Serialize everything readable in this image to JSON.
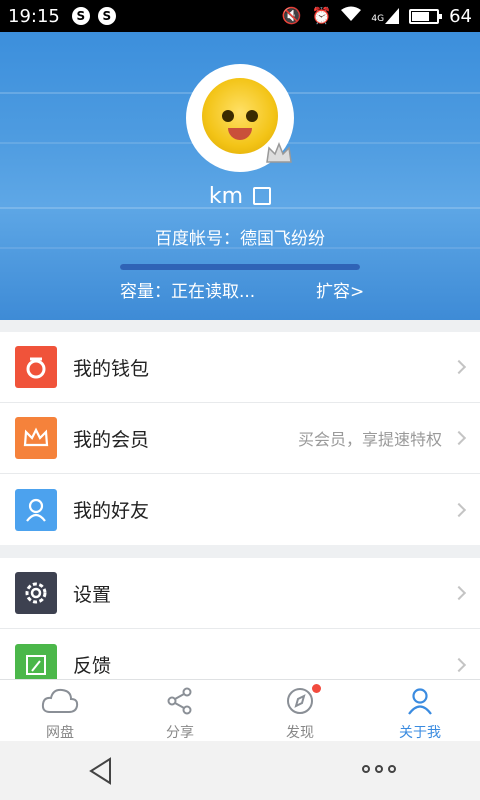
{
  "status_bar": {
    "time": "19:15",
    "battery": "64",
    "battery_level": 0.64,
    "network": "4G",
    "icons": [
      "notification-s-icon",
      "notification-s-icon",
      "mute-icon",
      "alarm-icon",
      "wifi-icon",
      "signal-icon",
      "battery-icon"
    ]
  },
  "profile": {
    "username": "km",
    "account": "百度帐号：德国飞纷纷",
    "capacity": "容量：正在读取...",
    "expand": "扩容>",
    "storage_fill": 1.0
  },
  "menu": {
    "wallet": {
      "label": "我的钱包",
      "icon": "wallet-icon",
      "color": "#f0533a"
    },
    "vip": {
      "label": "我的会员",
      "hint": "买会员，享提速特权",
      "icon": "crown-icon",
      "color": "#f5823b"
    },
    "friends": {
      "label": "我的好友",
      "icon": "friend-icon",
      "color": "#4ca2ee"
    },
    "settings": {
      "label": "设置",
      "icon": "settings-gear-icon",
      "color": "#3d4150"
    },
    "feedback": {
      "label": "反馈",
      "icon": "feedback-icon",
      "color": "#4bb74a"
    }
  },
  "tabs": [
    {
      "label": "网盘",
      "icon": "cloud-icon"
    },
    {
      "label": "分享",
      "icon": "share-icon"
    },
    {
      "label": "发现",
      "icon": "compass-icon"
    },
    {
      "label": "关于我",
      "icon": "user-icon",
      "active": true
    }
  ],
  "colors": {
    "accent": "#3a8be0",
    "header": "#4d9be0",
    "badge": "#f24b3e"
  }
}
